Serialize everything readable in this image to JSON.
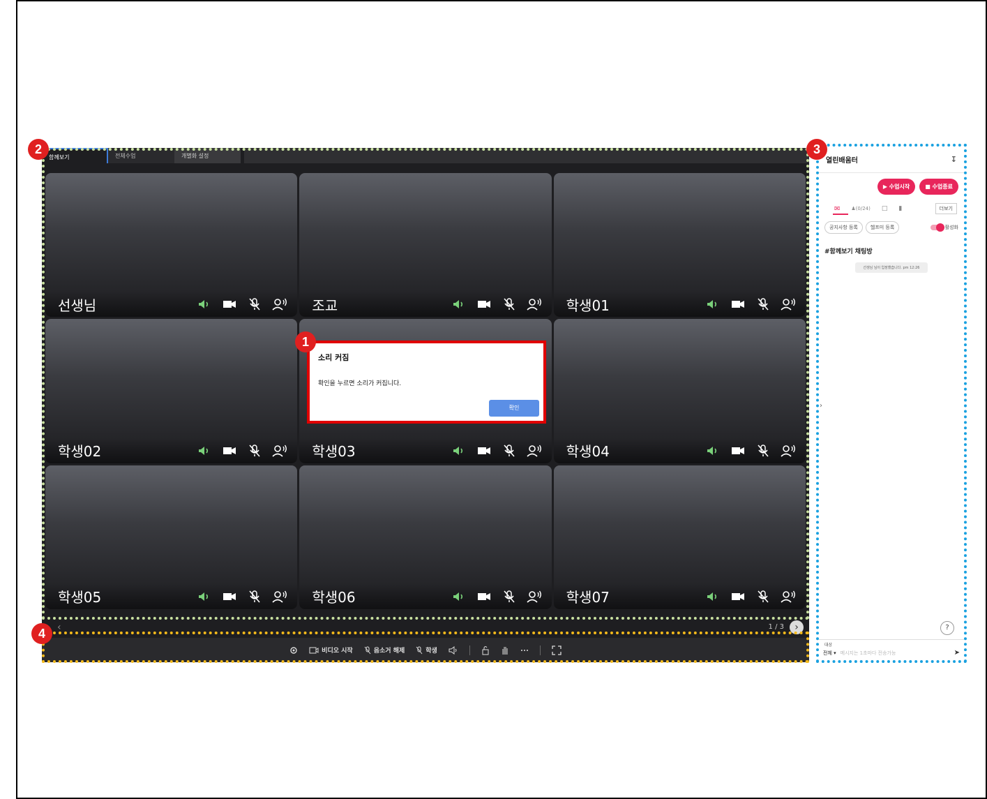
{
  "tabs": [
    "함께보기",
    "전체수업",
    "개별화 설정"
  ],
  "tiles": [
    {
      "name": "선생님"
    },
    {
      "name": "조교"
    },
    {
      "name": "학생01"
    },
    {
      "name": "학생02"
    },
    {
      "name": "학생03"
    },
    {
      "name": "학생04"
    },
    {
      "name": "학생05"
    },
    {
      "name": "학생06"
    },
    {
      "name": "학생07"
    }
  ],
  "pager": {
    "text": "1 / 3"
  },
  "toolbar": {
    "video_start": "비디오 시작",
    "unmute": "음소거 해제",
    "student": "학생"
  },
  "dialog": {
    "title": "소리 커짐",
    "message": "확인을 누르면 소리가 커집니다.",
    "confirm": "확인"
  },
  "panel": {
    "title": "열린배움터",
    "start_btn": "▶ 수업시작",
    "end_btn": "■ 수업종료",
    "participants": "(0/24)",
    "more": "더보기",
    "chip_notice": "공지사항 등록",
    "chip_help": "헬프미 등록",
    "toggle_label": "활성화",
    "chat_room": "#함께보기 채팅방",
    "chat_note": "선생님 님이 입장했습니다. pm 12:26",
    "target_label": "대상",
    "target_value": "전체",
    "message_placeholder": "메시지는 1초마다 전송가능"
  },
  "badges": [
    "1",
    "2",
    "3",
    "4"
  ],
  "colors": {
    "accent": "#e8265b",
    "dialog_border": "#e00000",
    "confirm": "#5b8fe6",
    "green_icon": "#7ad07a"
  }
}
